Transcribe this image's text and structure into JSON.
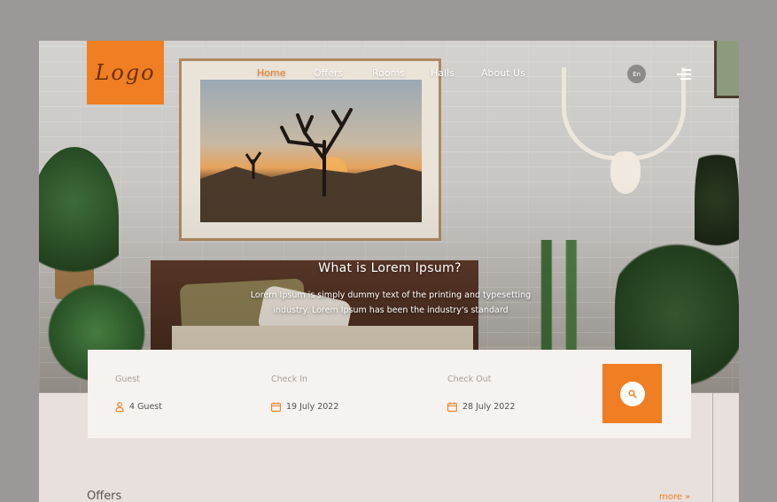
{
  "brand": {
    "logo_text": "Logo",
    "accent_color": "#f07e22"
  },
  "nav": {
    "items": [
      {
        "label": "Home",
        "active": true
      },
      {
        "label": "Offers",
        "active": false
      },
      {
        "label": "Rooms",
        "active": false
      },
      {
        "label": "Halls",
        "active": false
      },
      {
        "label": "About Us",
        "active": false
      }
    ],
    "language": "En",
    "menu_icon": "hamburger-menu-icon"
  },
  "hero": {
    "title": "What is Lorem Ipsum?",
    "description": "Lorem Ipsum is simply dummy text of the printing and typesetting industry. Lorem Ipsum has been the industry's standard"
  },
  "booking": {
    "guest": {
      "label": "Guest",
      "value": "4 Guest",
      "icon": "person-icon"
    },
    "check_in": {
      "label": "Check In",
      "value": "19 July 2022",
      "icon": "calendar-icon"
    },
    "check_out": {
      "label": "Check Out",
      "value": "28 July 2022",
      "icon": "calendar-icon"
    },
    "search_icon": "search-icon"
  },
  "offers": {
    "title": "Offers",
    "more_label": "more »"
  }
}
